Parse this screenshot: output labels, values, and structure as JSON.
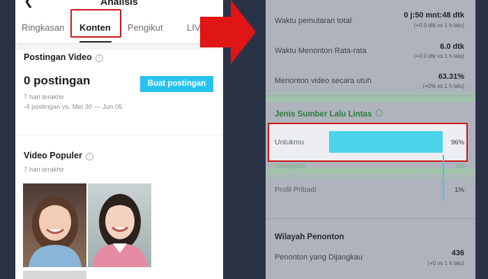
{
  "left": {
    "title": "Analisis",
    "back_icon": "chevron-left-icon",
    "tabs": [
      {
        "label": "Ringkasan",
        "active": false
      },
      {
        "label": "Konten",
        "active": true
      },
      {
        "label": "Pengikut",
        "active": false
      },
      {
        "label": "LIV",
        "active": false
      }
    ],
    "posts_section": {
      "title": "Postingan Video",
      "info_icon": "info-icon",
      "count": "0 postingan",
      "period": "7 hari terakhir",
      "comparison": "-4 postingan vs. Mei 30 — Jun 05",
      "create_button": "Buat postingan"
    },
    "popular_section": {
      "title": "Video Populer",
      "info_icon": "info-icon",
      "period": "7 hari terakhir"
    }
  },
  "right": {
    "metrics": [
      {
        "label": "Waktu pemutaran total",
        "value": "0 j:50 mnt:48 dtk",
        "sub": "(+0.0 dtk vs 1 h lalu)"
      },
      {
        "label": "Waktu Menonton Rata-rata",
        "value": "6.0 dtk",
        "sub": "(+0.0 dtk vs 1 h lalu)"
      },
      {
        "label": "Menonton video secara utuh",
        "value": "63.31%",
        "sub": "(+0% vs 1 h lalu)"
      }
    ],
    "traffic": {
      "title": "Jenis Sumber Lalu Lintas",
      "info_icon": "info-icon",
      "sources": [
        {
          "label": "Untukmu",
          "percent": "96%",
          "value": 96
        },
        {
          "label": "Mengikuti",
          "percent": "2%",
          "value": 2
        },
        {
          "label": "Profil Pribadi",
          "percent": "1%",
          "value": 1
        }
      ]
    },
    "region": {
      "title": "Wilayah Penonton",
      "reach_label": "Penonton yang Dijangkau",
      "reach_value": "436",
      "reach_sub": "(+0 vs 1 h lalu)"
    }
  },
  "colors": {
    "highlight_red": "#cc1818",
    "arrow_red": "#e01515",
    "bar_cyan": "#4bd4ea",
    "button_cyan": "#27c3f0",
    "green_title": "#2e7d3a"
  }
}
